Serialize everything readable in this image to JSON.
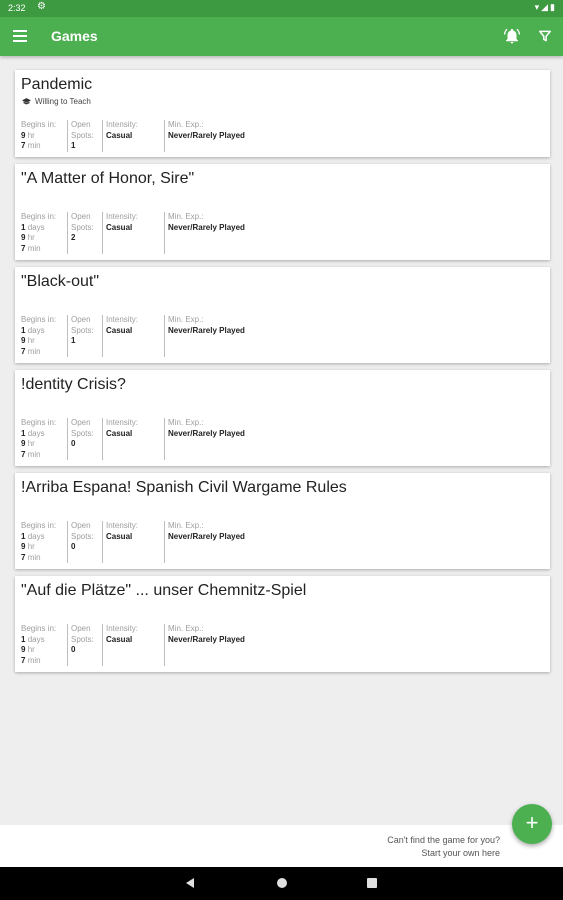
{
  "status": {
    "time": "2:32"
  },
  "app_bar": {
    "title": "Games"
  },
  "labels": {
    "begins_in": "Begins in:",
    "open": "Open",
    "spots": "Spots:",
    "intensity": "Intensity:",
    "min_exp": "Min. Exp.:",
    "days": "days",
    "hr": "hr",
    "min": "min"
  },
  "games": [
    {
      "title": "Pandemic",
      "tag": "Willing to Teach",
      "begins": {
        "days": "",
        "hr": "9",
        "min": "7"
      },
      "open_spots": "1",
      "intensity": "Casual",
      "min_exp": "Never/Rarely Played"
    },
    {
      "title": "\"A Matter of Honor, Sire\"",
      "tag": "",
      "begins": {
        "days": "1",
        "hr": "9",
        "min": "7"
      },
      "open_spots": "2",
      "intensity": "Casual",
      "min_exp": "Never/Rarely Played"
    },
    {
      "title": "\"Black-out\"",
      "tag": "",
      "begins": {
        "days": "1",
        "hr": "9",
        "min": "7"
      },
      "open_spots": "1",
      "intensity": "Casual",
      "min_exp": "Never/Rarely Played"
    },
    {
      "title": "!dentity Crisis?",
      "tag": "",
      "begins": {
        "days": "1",
        "hr": "9",
        "min": "7"
      },
      "open_spots": "0",
      "intensity": "Casual",
      "min_exp": "Never/Rarely Played"
    },
    {
      "title": "!Arriba Espana! Spanish Civil Wargame Rules",
      "tag": "",
      "begins": {
        "days": "1",
        "hr": "9",
        "min": "7"
      },
      "open_spots": "0",
      "intensity": "Casual",
      "min_exp": "Never/Rarely Played"
    },
    {
      "title": "\"Auf die Plätze\" ... unser Chemnitz-Spiel",
      "tag": "",
      "begins": {
        "days": "1",
        "hr": "9",
        "min": "7"
      },
      "open_spots": "0",
      "intensity": "Casual",
      "min_exp": "Never/Rarely Played"
    }
  ],
  "footer": {
    "cta_line1": "Can't find the game for you?",
    "cta_line2": "Start your own here",
    "fab_icon": "+"
  },
  "icons": {
    "menu": "menu-icon",
    "notifications": "bell-icon",
    "filter": "filter-icon",
    "add": "plus-icon"
  },
  "colors": {
    "primary": "#4caf50",
    "status_bar": "#3e9a41",
    "background": "#eeeeee"
  }
}
